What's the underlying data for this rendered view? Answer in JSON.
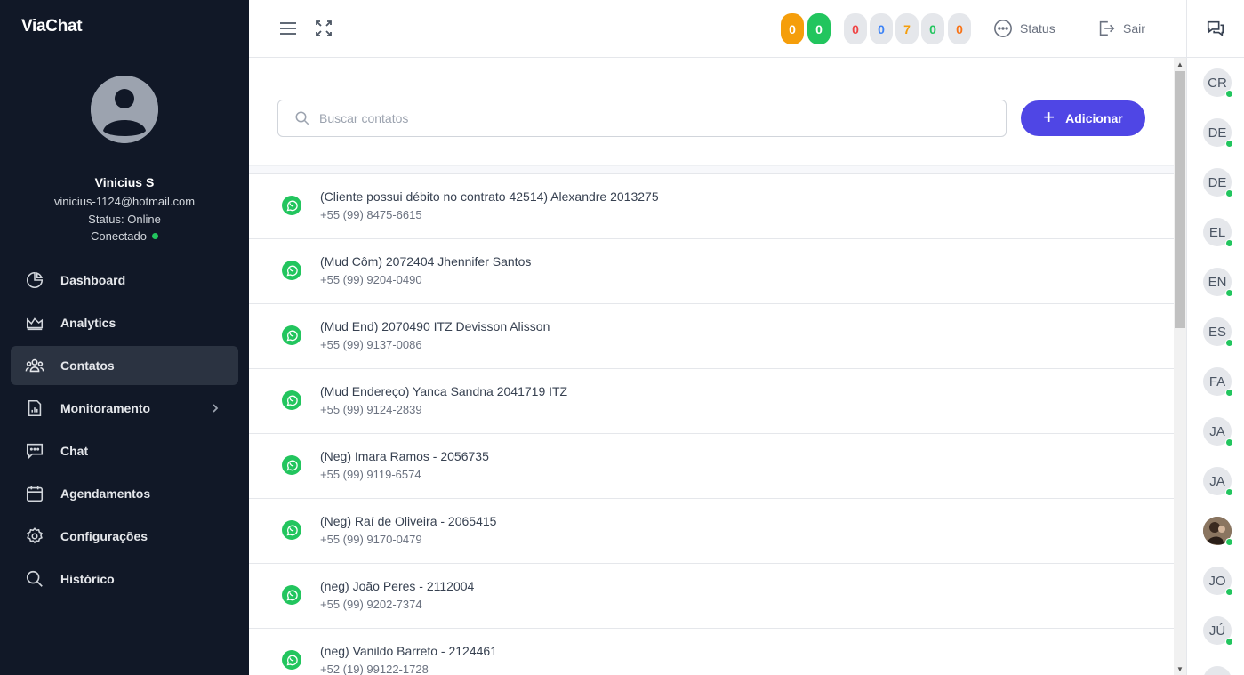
{
  "app": {
    "logo": "ViaChat"
  },
  "user": {
    "name": "Vinicius S",
    "email": "vinicius-1124@hotmail.com",
    "status": "Status: Online",
    "connection": "Conectado"
  },
  "nav": [
    {
      "label": "Dashboard",
      "icon": "pie-chart-icon"
    },
    {
      "label": "Analytics",
      "icon": "area-chart-icon"
    },
    {
      "label": "Contatos",
      "icon": "users-icon",
      "active": true
    },
    {
      "label": "Monitoramento",
      "icon": "bar-report-icon",
      "has_submenu": true
    },
    {
      "label": "Chat",
      "icon": "chat-bubble-icon"
    },
    {
      "label": "Agendamentos",
      "icon": "calendar-icon"
    },
    {
      "label": "Configurações",
      "icon": "gear-icon"
    },
    {
      "label": "Histórico",
      "icon": "search-icon"
    }
  ],
  "header": {
    "badges_primary": [
      {
        "value": "0",
        "color": "#f59e0b"
      },
      {
        "value": "0",
        "color": "#22c55e"
      }
    ],
    "badges_secondary": [
      {
        "value": "0",
        "text_color": "#ef4444"
      },
      {
        "value": "0",
        "text_color": "#3b82f6"
      },
      {
        "value": "7",
        "text_color": "#f59e0b"
      },
      {
        "value": "0",
        "text_color": "#22c55e"
      },
      {
        "value": "0",
        "text_color": "#f97316"
      }
    ],
    "status_label": "Status",
    "logout_label": "Sair"
  },
  "search": {
    "placeholder": "Buscar contatos"
  },
  "add_button": {
    "label": "Adicionar"
  },
  "contacts": [
    {
      "name": "(Cliente possui débito no contrato 42514) Alexandre 2013275",
      "phone": "+55 (99) 8475-6615"
    },
    {
      "name": "(Mud Côm) 2072404 Jhennifer Santos",
      "phone": "+55 (99) 9204-0490"
    },
    {
      "name": "(Mud End) 2070490 ITZ Devisson Alisson",
      "phone": "+55 (99) 9137-0086"
    },
    {
      "name": "(Mud Endereço) Yanca Sandna 2041719 ITZ",
      "phone": "+55 (99) 9124-2839"
    },
    {
      "name": "(Neg) Imara Ramos - 2056735",
      "phone": "+55 (99) 9119-6574"
    },
    {
      "name": "(Neg) Raí de Oliveira - 2065415",
      "phone": "+55 (99) 9170-0479"
    },
    {
      "name": "(neg) João Peres - 2112004",
      "phone": "+55 (99) 9202-7374"
    },
    {
      "name": "(neg) Vanildo Barreto - 2124461",
      "phone": "+52 (19) 99122-1728"
    }
  ],
  "online_users": [
    "CR",
    "DE",
    "DE",
    "EL",
    "EN",
    "ES",
    "FA",
    "JA",
    "JA",
    "",
    "JO",
    "JÚ"
  ]
}
